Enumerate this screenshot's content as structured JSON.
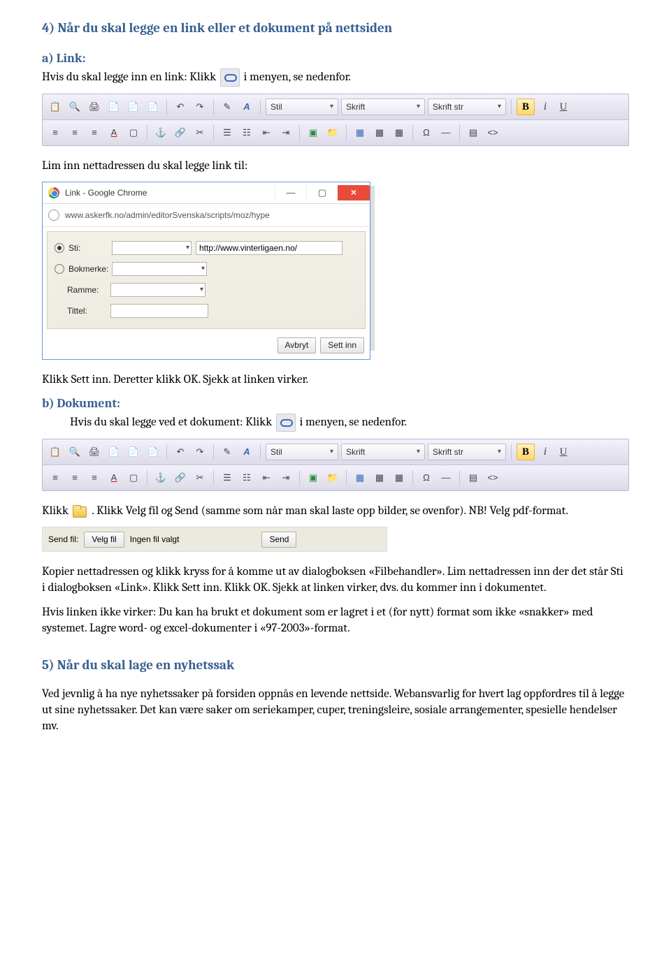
{
  "section4": {
    "title": "4) Når du skal legge en link eller et dokument på nettsiden",
    "a_label": "a)   Link:",
    "a_text1": "Hvis du skal legge inn en link: Klikk ",
    "a_text2": " i menyen, se nedenfor.",
    "lim_text": "Lim inn nettadressen du skal legge link til:",
    "after_dialog": "Klikk Sett inn. Deretter klikk OK. Sjekk at linken virker.",
    "b_label": "b)   Dokument:",
    "b_text1": "Hvis du skal legge ved et dokument: Klikk ",
    "b_text2": " i menyen, se nedenfor.",
    "klikk_pre": "Klikk ",
    "klikk_post": " . Klikk Velg fil og Send (samme som når man skal laste opp bilder, se ovenfor). NB! Velg pdf-format.",
    "kopier": "Kopier nettadressen og klikk kryss for å komme ut av dialogboksen «Filbehandler». Lim nettadressen inn der det står Sti i dialogboksen «Link». Klikk Sett inn. Klikk OK. Sjekk at linken virker, dvs. du kommer inn i dokumentet.",
    "hvis": "Hvis linken ikke virker: Du kan ha brukt et dokument som er lagret i et (for nytt) format som ikke «snakker» med systemet. Lagre word- og excel-dokumenter i «97-2003»-format."
  },
  "section5": {
    "title": "5) Når du skal lage en nyhetssak",
    "text": "Ved jevnlig å ha nye nyhetssaker på forsiden oppnås en levende nettside. Webansvarlig for hvert lag oppfordres til å legge ut sine nyhetssaker. Det kan være saker om seriekamper, cuper, treningsleire, sosiale arrangementer, spesielle hendelser mv."
  },
  "toolbar": {
    "stil": "Stil",
    "skrift": "Skrift",
    "skrift_str": "Skrift str",
    "B": "B",
    "i": "i",
    "U": "U",
    "omega": "Ω"
  },
  "dialog": {
    "title": "Link - Google Chrome",
    "url_display": "www.askerfk.no/admin/editorSvenska/scripts/moz/hype",
    "sti_label": "Sti:",
    "sti_value": "http://www.vinterligaen.no/",
    "bokmerke_label": "Bokmerke:",
    "ramme_label": "Ramme:",
    "tittel_label": "Tittel:",
    "avbryt": "Avbryt",
    "settinn": "Sett inn"
  },
  "filebar": {
    "label": "Send fil:",
    "velg": "Velg fil",
    "none": "Ingen fil valgt",
    "send": "Send"
  }
}
